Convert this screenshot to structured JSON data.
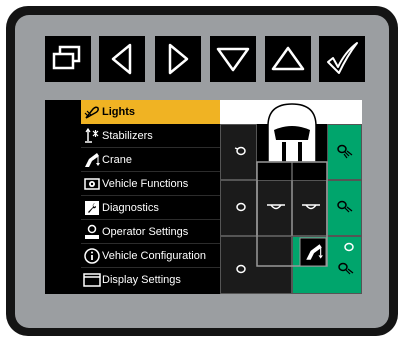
{
  "toolbar": {
    "buttons": [
      {
        "name": "windows-button",
        "icon": "overlapping-windows-icon"
      },
      {
        "name": "left-button",
        "icon": "triangle-left-icon"
      },
      {
        "name": "right-button",
        "icon": "triangle-right-icon"
      },
      {
        "name": "down-button",
        "icon": "triangle-down-icon"
      },
      {
        "name": "up-button",
        "icon": "triangle-up-icon"
      },
      {
        "name": "confirm-button",
        "icon": "checkmark-icon"
      }
    ]
  },
  "menu": {
    "items": [
      {
        "label": "Lights",
        "icon": "lights-icon",
        "selected": true
      },
      {
        "label": "Stabilizers",
        "icon": "stabilizer-icon"
      },
      {
        "label": "Crane",
        "icon": "crane-icon"
      },
      {
        "label": "Vehicle Functions",
        "icon": "vehicle-functions-icon"
      },
      {
        "label": "Diagnostics",
        "icon": "wrench-icon"
      },
      {
        "label": "Operator Settings",
        "icon": "operator-icon"
      },
      {
        "label": "Vehicle Configuration",
        "icon": "info-icon"
      },
      {
        "label": "Display Settings",
        "icon": "display-icon"
      }
    ]
  },
  "colors": {
    "selection": "#f0b323",
    "light_on": "#00a56c",
    "light_off": "#1b1b1b",
    "bezel": "#9b9ea1"
  },
  "lights_grid": {
    "cells": [
      {
        "id": "front-left",
        "state": "off"
      },
      {
        "id": "front-right",
        "state": "on"
      },
      {
        "id": "middle-left",
        "state": "off"
      },
      {
        "id": "middle-right",
        "state": "on"
      },
      {
        "id": "rear-left",
        "state": "off"
      },
      {
        "id": "rear-right",
        "state": "on"
      }
    ]
  }
}
